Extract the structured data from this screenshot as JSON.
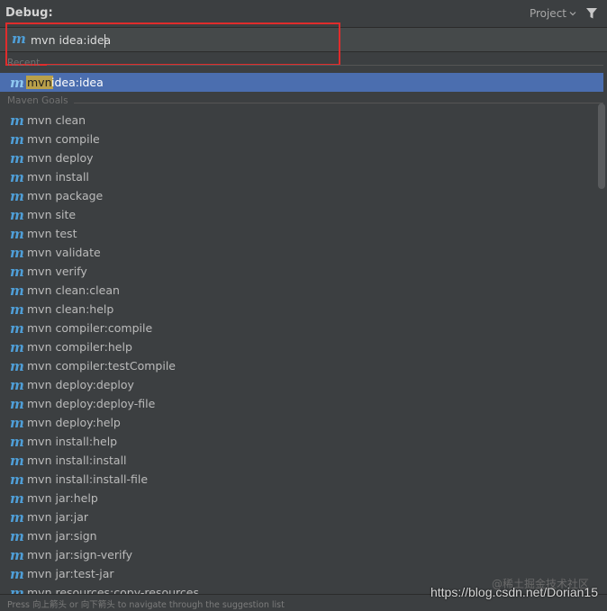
{
  "header": {
    "title": "Debug:",
    "scope_label": "Project",
    "scope_chevron_icon": "chevron-down-icon",
    "filter_icon": "filter-icon"
  },
  "command_input": {
    "icon": "maven-icon",
    "icon_glyph": "m",
    "value": "mvn idea:idea"
  },
  "recent": {
    "label": "Recent",
    "items": [
      {
        "match": "mvn",
        "rest": " idea:idea"
      }
    ]
  },
  "maven_goals": {
    "label": "Maven Goals",
    "items": [
      "mvn clean",
      "mvn compile",
      "mvn deploy",
      "mvn install",
      "mvn package",
      "mvn site",
      "mvn test",
      "mvn validate",
      "mvn verify",
      "mvn clean:clean",
      "mvn clean:help",
      "mvn compiler:compile",
      "mvn compiler:help",
      "mvn compiler:testCompile",
      "mvn deploy:deploy",
      "mvn deploy:deploy-file",
      "mvn deploy:help",
      "mvn install:help",
      "mvn install:install",
      "mvn install:install-file",
      "mvn jar:help",
      "mvn jar:jar",
      "mvn jar:sign",
      "mvn jar:sign-verify",
      "mvn jar:test-jar",
      "mvn resources:copy-resources"
    ]
  },
  "status_bar": {
    "hint": "Press 向上箭头 or 向下箭头 to navigate through the suggestion list"
  },
  "watermark": {
    "top": "@稀土掘金技术社区",
    "url": "https://blog.csdn.net/Dorian15"
  },
  "colors": {
    "background": "#3c3f41",
    "selection": "#4b6eaf",
    "match_highlight": "#b9a04a",
    "maven_icon": "#4f9fd8",
    "callout_border": "#e02c2c"
  }
}
